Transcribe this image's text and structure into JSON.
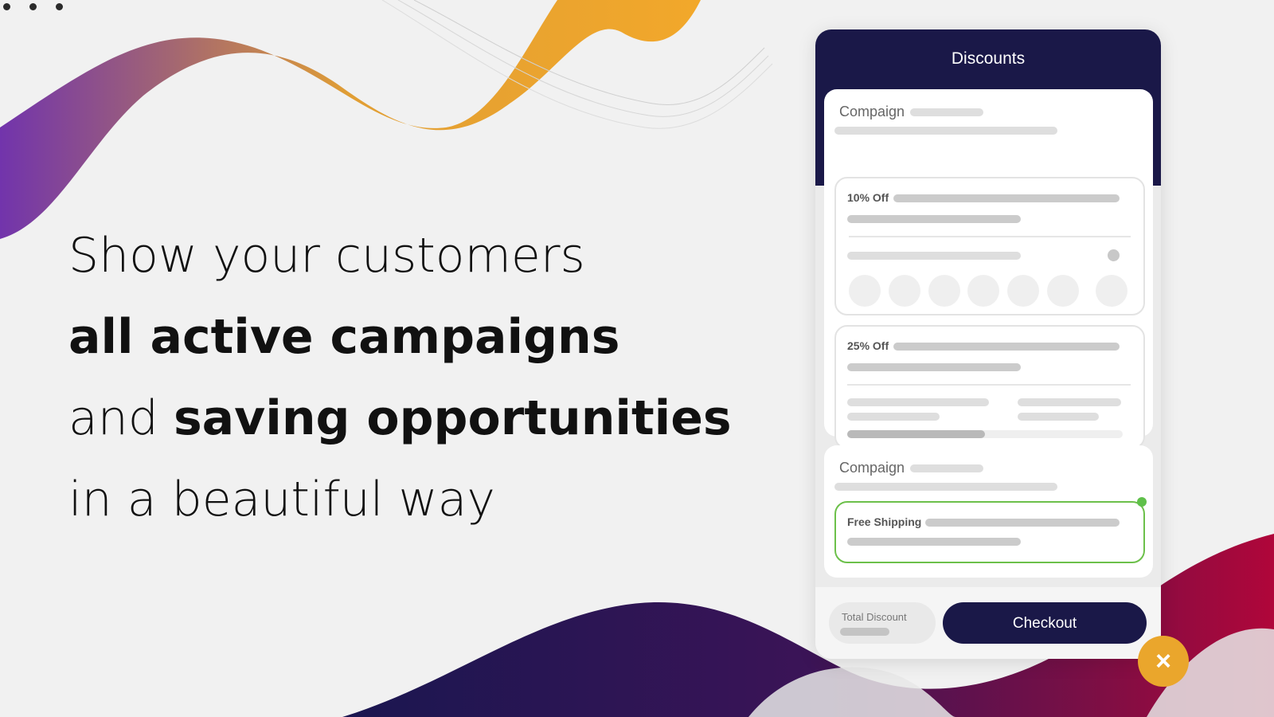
{
  "headline": {
    "line1": "Show your customers",
    "line2": "all active campaigns",
    "line3_prefix": "and ",
    "line3_bold": "saving opportunities",
    "line4": "in a beautiful way"
  },
  "colors": {
    "navy": "#1a1848",
    "accent_orange": "#eaa62c",
    "active_green": "#6cc04a",
    "background": "#f1f1f1"
  },
  "phone": {
    "title": "Discounts",
    "campaigns": [
      {
        "label": "Compaign",
        "offers": [
          {
            "label": "10% Off"
          },
          {
            "label": "25% Off",
            "progress": 0.5
          }
        ]
      },
      {
        "label": "Compaign",
        "offers": [
          {
            "label": "Free Shipping",
            "active": true
          }
        ]
      }
    ],
    "footer": {
      "total_label": "Total Discount",
      "checkout_label": "Checkout"
    },
    "close_icon": "×"
  },
  "icons": {
    "menu": "three-dots-icon",
    "close": "close-icon"
  }
}
